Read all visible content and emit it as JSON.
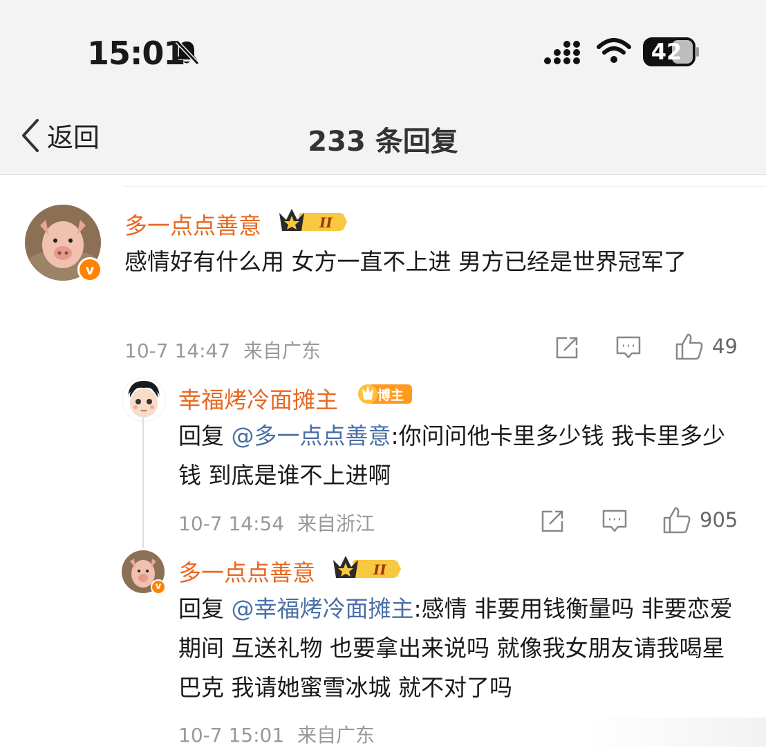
{
  "status_bar": {
    "time": "15:01",
    "battery": "42"
  },
  "nav": {
    "back_label": "返回",
    "title": "233 条回复"
  },
  "comments": [
    {
      "username": "多一点点善意",
      "text": "感情好有什么用 女方一直不上进 男方已经是世界冠军了",
      "date": "10-7 14:47",
      "location": "来自广东",
      "likes": "49",
      "badge": "II"
    },
    {
      "username": "幸福烤冷面摊主",
      "reply_prefix": "回复 ",
      "mention": "@多一点点善意",
      "text": ":你问问他卡里多少钱 我卡里多少钱 到底是谁不上进啊",
      "date": "10-7 14:54",
      "location": "来自浙江",
      "likes": "905",
      "badge": "博主"
    },
    {
      "username": "多一点点善意",
      "reply_prefix": "回复 ",
      "mention": "@幸福烤冷面摊主",
      "text": ":感情 非要用钱衡量吗 非要恋爱期间 互送礼物 也要拿出来说吗 就像我女朋友请我喝星巴克 我请她蜜雪冰城 就不对了吗",
      "date": "10-7 15:01",
      "location": "来自广东",
      "badge": "II"
    }
  ],
  "colors": {
    "username": "#e8681f",
    "mention": "#4a6fa5",
    "meta": "#999999",
    "verified": "#ff8200"
  }
}
